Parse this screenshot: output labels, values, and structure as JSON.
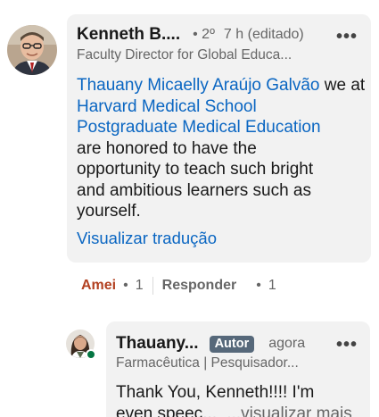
{
  "comment": {
    "author_name": "Kenneth B....",
    "degree": "• 2º",
    "time": "7 h (editado)",
    "more": "•••",
    "headline": "Faculty Director for Global Educa...",
    "mention_person": "Thauany Micaelly Araújo Galvão",
    "text_1": "we at",
    "mention_org_line1": "Harvard Medical School",
    "mention_org_line2": "Postgraduate Medical Education",
    "text_lines": [
      "are honored to have the",
      "opportunity to teach such bright",
      "and ambitious learners such as",
      "yourself."
    ],
    "translate_link": "Visualizar tradução"
  },
  "comment_actions": {
    "reaction": "Amei",
    "bullet": "•",
    "reaction_count": "1",
    "reply": "Responder",
    "reply_count": "1"
  },
  "reply": {
    "author_name": "Thauany...",
    "badge": "Autor",
    "time": "agora",
    "more": "•••",
    "headline": "Farmacêutica | Pesquisador...",
    "text_line1": "Thank You, Kenneth!!!! I'm",
    "text_line2": "even speec...",
    "see_more": "...visualizar mais"
  },
  "colors": {
    "link": "#0a66c2",
    "reaction": "#b24020",
    "badge_bg": "#56687a",
    "bubble_bg": "#f2f2f2",
    "online": "#057642"
  }
}
